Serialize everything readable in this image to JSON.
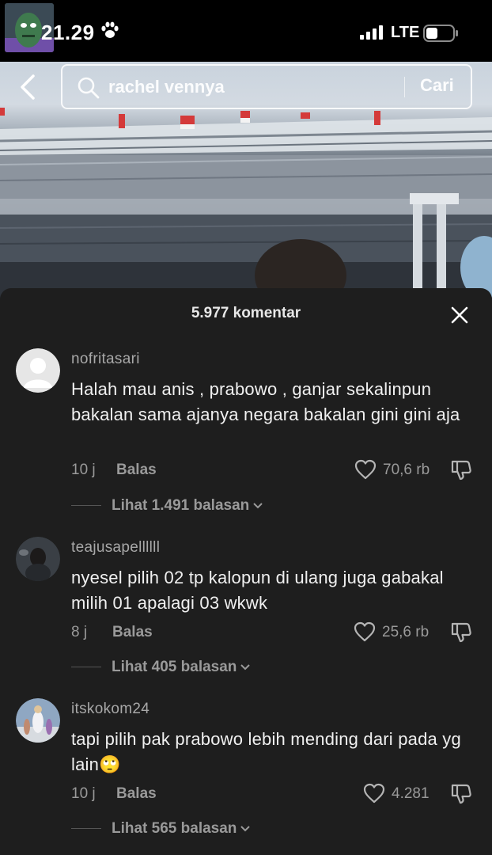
{
  "status_bar": {
    "time": "21.29",
    "network": "LTE"
  },
  "search": {
    "query": "rachel vennya",
    "submit_label": "Cari"
  },
  "comments_header": {
    "count_label": "5.977 komentar"
  },
  "comments": [
    {
      "username": "nofritasari",
      "text": "Halah mau anis , prabowo , ganjar sekalinpun bakalan sama ajanya negara bakalan gini gini aja",
      "time": "10 j",
      "reply_label": "Balas",
      "likes": "70,6 rb",
      "view_replies": "Lihat 1.491 balasan"
    },
    {
      "username": "teajusapellllll",
      "text": "nyesel pilih 02 tp kalopun di ulang juga gabakal milih 01 apalagi 03 wkwk",
      "time": "8 j",
      "reply_label": "Balas",
      "likes": "25,6 rb",
      "view_replies": "Lihat 405 balasan"
    },
    {
      "username": "itskokom24",
      "text": "tapi pilih pak prabowo lebih mending dari pada yg lain🙄",
      "time": "10 j",
      "reply_label": "Balas",
      "likes": "4.281",
      "view_replies": "Lihat 565 balasan"
    }
  ],
  "colors": {
    "sheet_bg": "#1e1e1e",
    "muted_text": "#9a9a9a",
    "primary_text": "#f0f0f0"
  },
  "icons": [
    "paw-icon",
    "signal-icon",
    "battery-icon",
    "back-arrow-icon",
    "search-icon",
    "close-icon",
    "heart-icon",
    "dislike-icon",
    "chevron-down-icon"
  ]
}
